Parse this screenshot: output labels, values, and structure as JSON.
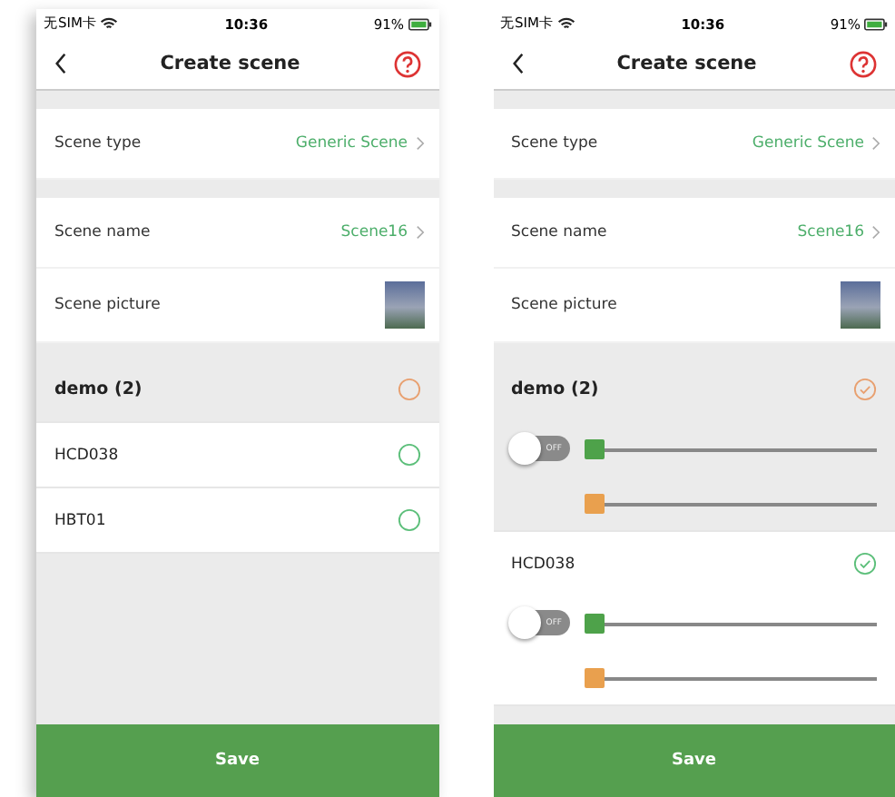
{
  "screens": [
    {
      "status_bar": {
        "carrier": "无SIM卡",
        "time": "10:36",
        "battery": "91%"
      },
      "title": "Create scene",
      "settings": [
        {
          "kind": "value",
          "label": "Scene type",
          "value": "Generic Scene",
          "gap_before": true
        },
        {
          "kind": "value",
          "label": "Scene name",
          "value": "Scene16",
          "gap_before": true
        },
        {
          "kind": "picture",
          "label": "Scene picture",
          "gap_before": false
        }
      ],
      "devices": [
        {
          "kind": "group",
          "name": "demo (2)",
          "selected": false
        },
        {
          "kind": "device",
          "name": "HCD038",
          "selected": false
        },
        {
          "kind": "device",
          "name": "HBT01",
          "selected": false
        }
      ],
      "save": "Save"
    },
    {
      "status_bar": {
        "carrier": "无SIM卡",
        "time": "10:36",
        "battery": "91%"
      },
      "title": "Create scene",
      "settings": [
        {
          "kind": "value",
          "label": "Scene type",
          "value": "Generic Scene",
          "gap_before": true
        },
        {
          "kind": "value",
          "label": "Scene name",
          "value": "Scene16",
          "gap_before": true
        },
        {
          "kind": "picture",
          "label": "Scene picture",
          "gap_before": false
        }
      ],
      "devices": [
        {
          "kind": "group",
          "name": "demo (2)",
          "selected": true,
          "controls": {
            "switch": {
              "label": "OFF",
              "on": false
            },
            "sliders": [
              {
                "color": "#4ea24a",
                "level": 0
              },
              {
                "color": "#e9a04e",
                "level": 0
              }
            ]
          }
        },
        {
          "kind": "device",
          "name": "HCD038",
          "selected": true,
          "controls": {
            "switch": {
              "label": "OFF",
              "on": false
            },
            "sliders": [
              {
                "color": "#4ea24a",
                "level": 0
              },
              {
                "color": "#e9a04e",
                "level": 0
              }
            ]
          }
        }
      ],
      "save": "Save"
    }
  ]
}
